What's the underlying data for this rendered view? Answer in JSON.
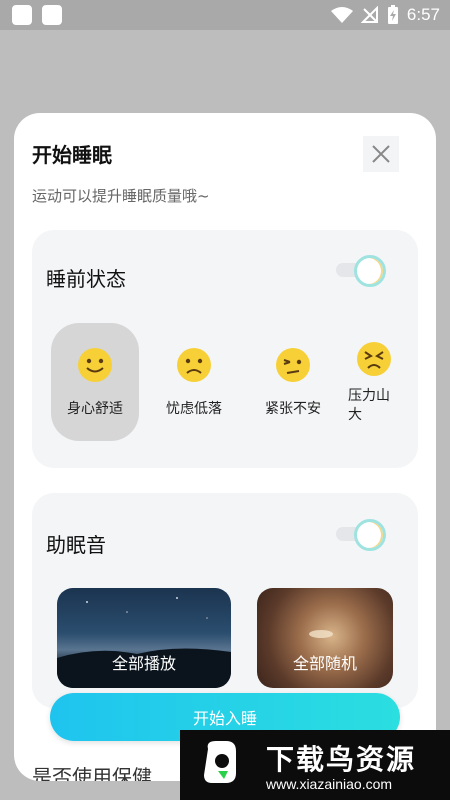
{
  "status_bar": {
    "time": "6:57"
  },
  "dialog": {
    "title": "开始睡眠",
    "subtitle": "运动可以提升睡眠质量哦~",
    "close_icon": "close-icon"
  },
  "sleep_state": {
    "title": "睡前状态",
    "toggle_on": true,
    "moods": [
      {
        "label": "身心舒适",
        "icon": "smile-face-icon",
        "selected": true
      },
      {
        "label": "忧虑低落",
        "icon": "sad-face-icon",
        "selected": false
      },
      {
        "label": "紧张不安",
        "icon": "nervous-face-icon",
        "selected": false
      },
      {
        "label": "压力山大",
        "icon": "stressed-face-icon",
        "selected": false
      }
    ]
  },
  "sleep_sound": {
    "title": "助眠音",
    "toggle_on": true,
    "options": [
      {
        "label": "全部播放"
      },
      {
        "label": "全部随机"
      }
    ]
  },
  "start_button": "开始入睡",
  "next_section_title": "是否使用保健",
  "watermark": {
    "name": "下载鸟资源",
    "url": "www.xiazainiao.com"
  },
  "colors": {
    "accent": "#22cfe6",
    "toggle_ring": "#9ee3e0",
    "face": "#f7d038"
  }
}
